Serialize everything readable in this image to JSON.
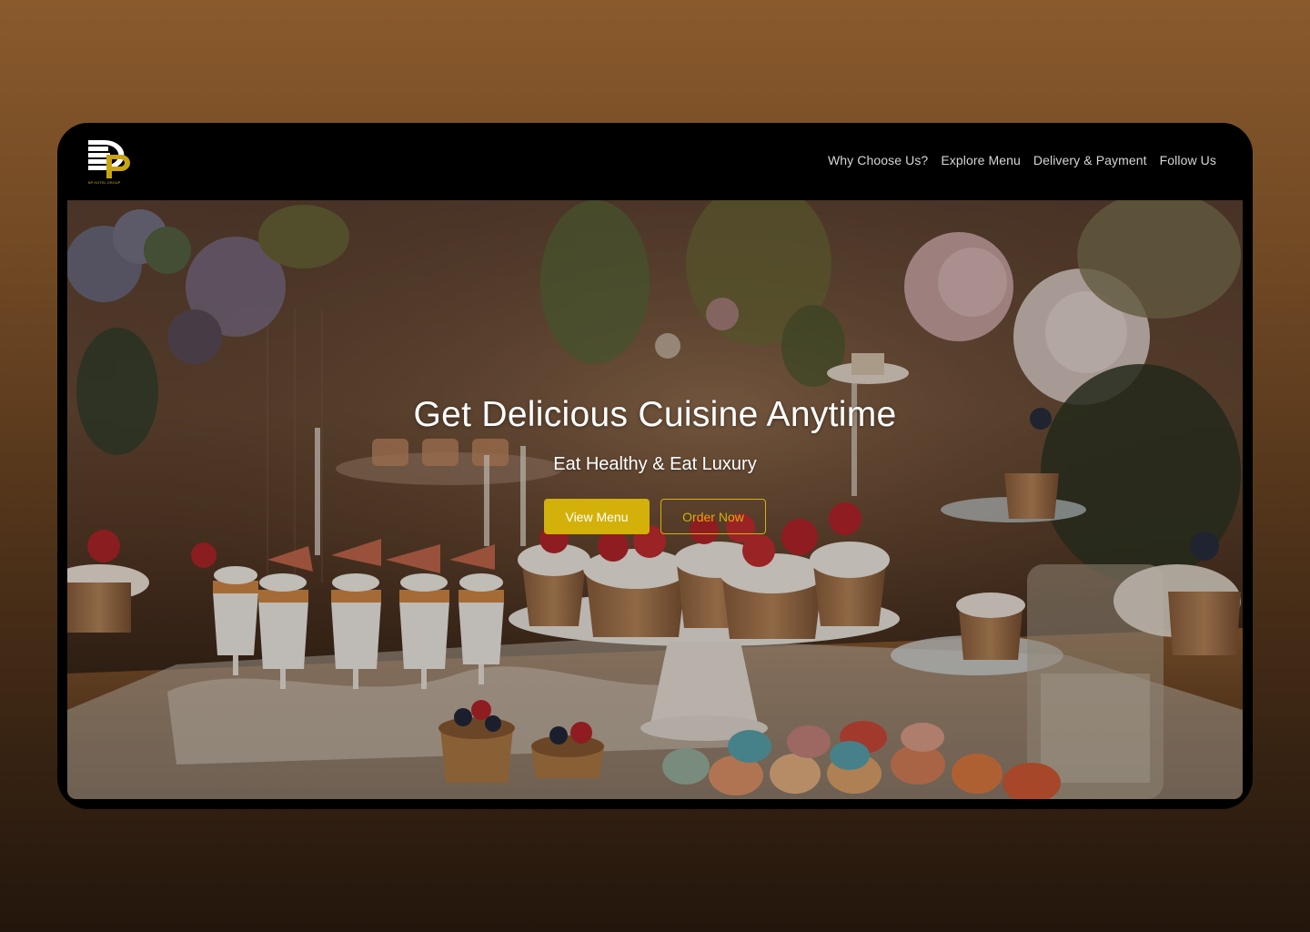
{
  "brand": {
    "logo_text": "BP HOTEL GROUP",
    "logo_primary_color": "#ffffff",
    "logo_accent_color": "#c8a415"
  },
  "nav": {
    "items": [
      {
        "label": "Why Choose Us?"
      },
      {
        "label": "Explore Menu"
      },
      {
        "label": "Delivery & Payment"
      },
      {
        "label": "Follow Us"
      }
    ]
  },
  "hero": {
    "title": "Get Delicious Cuisine Anytime",
    "subtitle": "Eat Healthy & Eat Luxury",
    "primary_button": "View Menu",
    "secondary_button": "Order Now",
    "accent_color": "#d3b10a",
    "background_image": "dessert-table-photo"
  },
  "colors": {
    "page_background_top": "#8a5a2c",
    "page_background_bottom": "#23160c",
    "navbar_background": "#000000",
    "nav_text": "#d6d6d6"
  }
}
